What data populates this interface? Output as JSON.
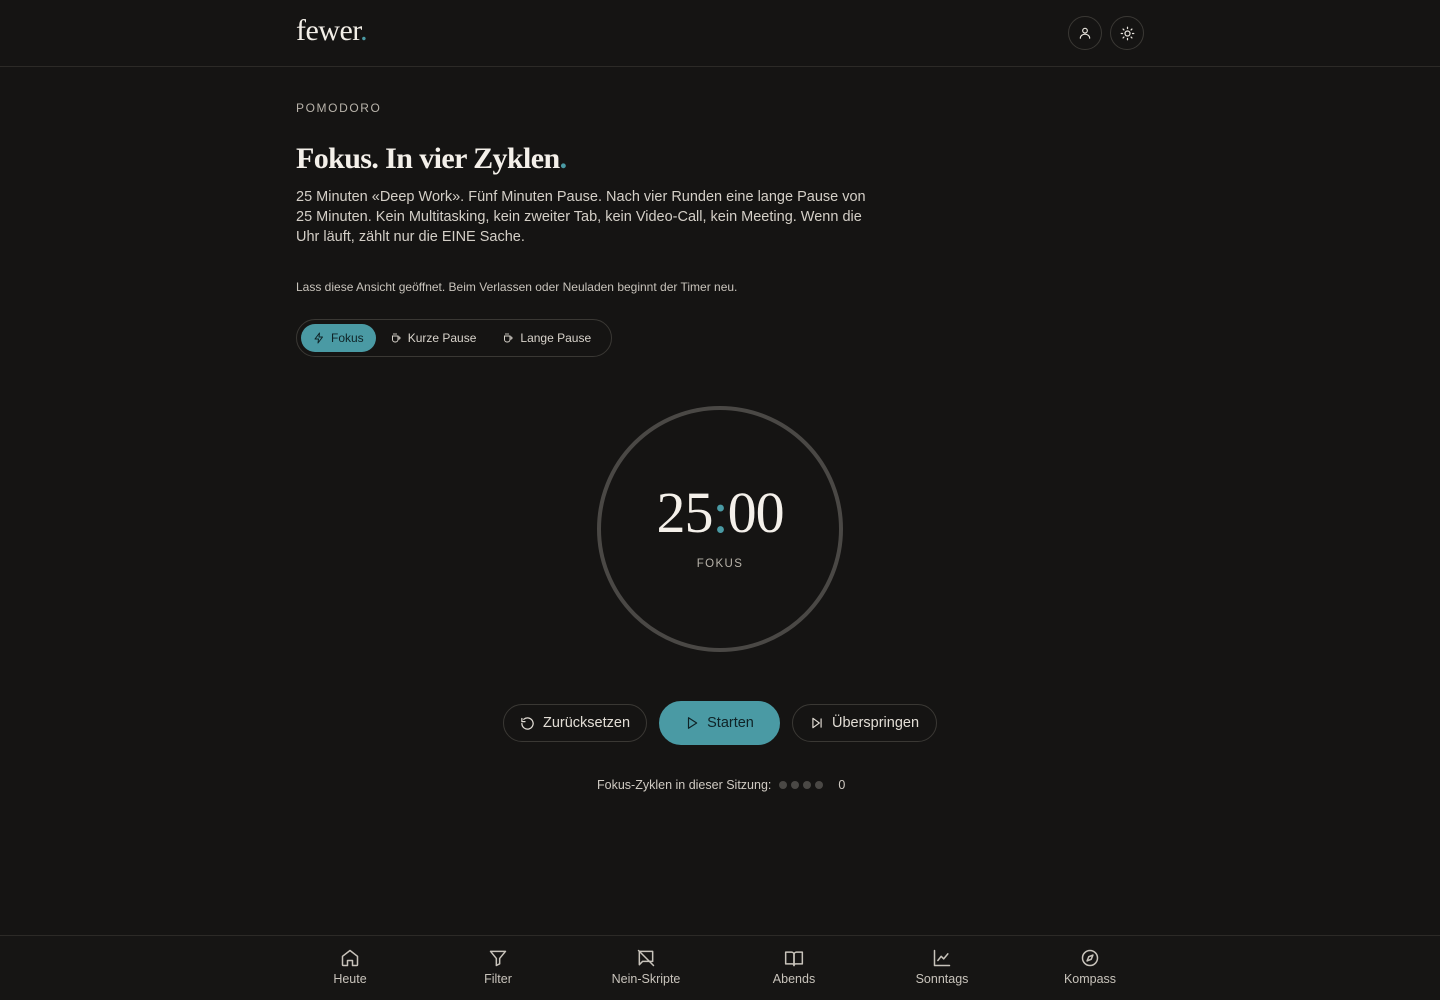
{
  "header": {
    "logo": "fewer",
    "logo_dot": ".",
    "user_icon": "user-icon",
    "theme_icon": "sun-icon"
  },
  "page": {
    "eyebrow": "POMODORO",
    "headline": "Fokus. In vier Zyklen",
    "headline_dot": ".",
    "intro": "25 Minuten «Deep Work». Fünf Minuten Pause. Nach vier Runden eine lange Pause von 25 Minuten. Kein Multitasking, kein zweiter Tab, kein Video-Call, kein Meeting. Wenn die Uhr läuft, zählt nur die EINE Sache.",
    "note": "Lass diese Ansicht geöffnet. Beim Verlassen oder Neuladen beginnt der Timer neu."
  },
  "modes": [
    {
      "label": "Fokus",
      "icon": "bolt-icon",
      "active": true
    },
    {
      "label": "Kurze Pause",
      "icon": "cup-icon",
      "active": false
    },
    {
      "label": "Lange Pause",
      "icon": "cup-icon",
      "active": false
    }
  ],
  "timer": {
    "minutes": "25",
    "separator": ":",
    "seconds": "00",
    "phase": "FOKUS",
    "progress": 0
  },
  "controls": {
    "reset_label": "Zurücksetzen",
    "start_label": "Starten",
    "skip_label": "Überspringen"
  },
  "cycles": {
    "label": "Fokus-Zyklen in dieser Sitzung:",
    "total": 4,
    "completed": 0,
    "count": "0"
  },
  "nav": [
    {
      "label": "Heute",
      "icon": "home-icon"
    },
    {
      "label": "Filter",
      "icon": "filter-icon"
    },
    {
      "label": "Nein-Skripte",
      "icon": "no-message-icon"
    },
    {
      "label": "Abends",
      "icon": "book-icon"
    },
    {
      "label": "Sonntags",
      "icon": "chart-icon"
    },
    {
      "label": "Kompass",
      "icon": "compass-icon"
    }
  ],
  "colors": {
    "background": "#151413",
    "accent": "#4a9aa4",
    "ring": "#4a4845"
  }
}
